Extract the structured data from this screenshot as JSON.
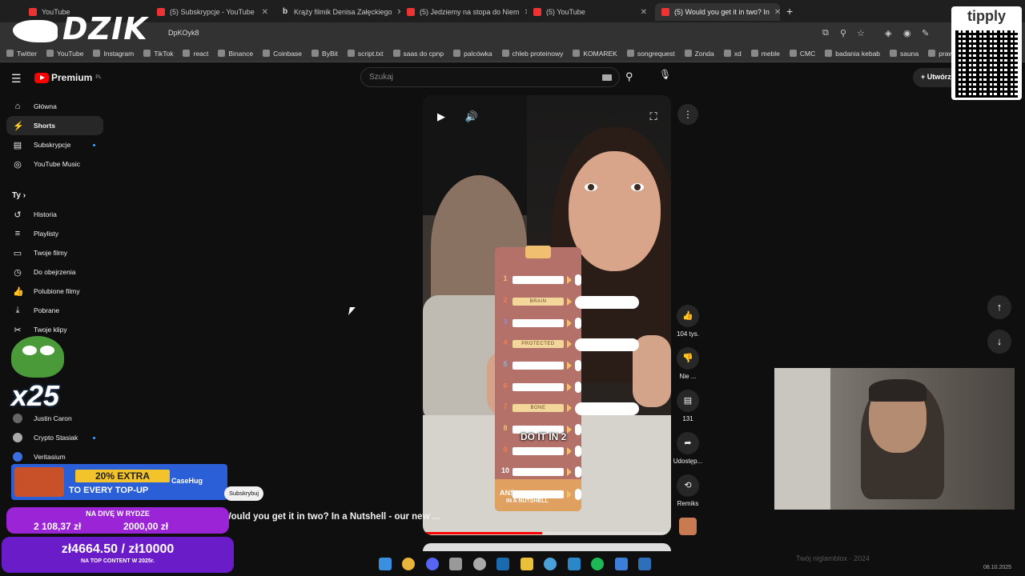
{
  "tabs": [
    {
      "title": "YouTube",
      "icon": "youtube-icon"
    },
    {
      "title": "(5) Subskrypcje - YouTube",
      "icon": "youtube-icon"
    },
    {
      "title": "Krąży filmik Denisa Załęckiego",
      "icon": "bing-icon"
    },
    {
      "title": "(5) Jedziemy na stopa do Niem",
      "icon": "youtube-icon"
    },
    {
      "title": "(5) YouTube",
      "icon": "youtube-icon"
    },
    {
      "title": "(5) Would you get it in two? In",
      "icon": "youtube-icon"
    }
  ],
  "address_bar": {
    "url": "DpKOyk8"
  },
  "bookmarks": [
    "Twitter",
    "YouTube",
    "Instagram",
    "TikTok",
    "react",
    "Binance",
    "Coinbase",
    "ByBit",
    "script.txt",
    "saas do cpnp",
    "palcówka",
    "chleb proteinowy",
    "KOMAREK",
    "songrequest",
    "Zonda",
    "xd",
    "meble",
    "CMC",
    "badania kebab",
    "sauna",
    "prawo jazdy"
  ],
  "overlay": {
    "streamer_logo": "DZIK",
    "tippy_brand": "tipply",
    "tippy_url": "https://tipply.pl/@dzik",
    "pepe_multiplier": "x25",
    "promo": {
      "line1": "20% EXTRA",
      "line2": "TO EVERY TOP-UP",
      "brand": "CaseHug"
    },
    "goal1": {
      "title": "NA DIVĘ W RYDZE",
      "current": "2 108,37 zł",
      "target": "2000,00 zł"
    },
    "goal2": {
      "title": "zł4664.50 / zł10000",
      "subtitle": "NA TOP CONTENT W 2025r."
    }
  },
  "header": {
    "logo_text": "Premium",
    "logo_region": "PL",
    "search_placeholder": "Szukaj",
    "create_label": "Utwórz"
  },
  "sidebar": {
    "main": [
      {
        "label": "Główna",
        "icon": "home-icon"
      },
      {
        "label": "Shorts",
        "icon": "shorts-icon"
      },
      {
        "label": "Subskrypcje",
        "icon": "subscriptions-icon"
      },
      {
        "label": "YouTube Music",
        "icon": "music-icon"
      }
    ],
    "you_section_title": "Ty",
    "you": [
      {
        "label": "Historia",
        "icon": "history-icon"
      },
      {
        "label": "Playlisty",
        "icon": "playlist-icon"
      },
      {
        "label": "Twoje filmy",
        "icon": "video-icon"
      },
      {
        "label": "Do obejrzenia",
        "icon": "clock-icon"
      },
      {
        "label": "Polubione filmy",
        "icon": "like-icon"
      },
      {
        "label": "Pobrane",
        "icon": "download-icon"
      },
      {
        "label": "Twoje klipy",
        "icon": "scissors-icon"
      }
    ],
    "subscriptions": [
      {
        "label": "Justin Caron"
      },
      {
        "label": "Crypto Stasiak"
      },
      {
        "label": "Veritasium"
      }
    ]
  },
  "short": {
    "board_rows": [
      {
        "num": "1",
        "label": ""
      },
      {
        "num": "2",
        "label": "BRAIN"
      },
      {
        "num": "3",
        "label": ""
      },
      {
        "num": "4",
        "label": "PROTECTED"
      },
      {
        "num": "5",
        "label": ""
      },
      {
        "num": "6",
        "label": ""
      },
      {
        "num": "7",
        "label": "BONE"
      },
      {
        "num": "8",
        "label": ""
      },
      {
        "num": "9",
        "label": ""
      },
      {
        "num": "10",
        "label": ""
      },
      {
        "num": "ANS",
        "label": ""
      }
    ],
    "caption": "DO IT IN 2",
    "board_footer": "IN A NUTSHELL",
    "progress": 0.48,
    "subscribe_label": "Subskrybuj",
    "title": "Would you get it in two? In a Nutshell - our new ..."
  },
  "actions": {
    "like_count": "104 tys.",
    "dislike_label": "Nie ...",
    "comments_count": "131",
    "share_label": "Udostęp...",
    "remix_label": "Remiks"
  },
  "taskbar": {
    "text": "Twój niglamblox · 2024",
    "clock": "08.10.2025"
  }
}
